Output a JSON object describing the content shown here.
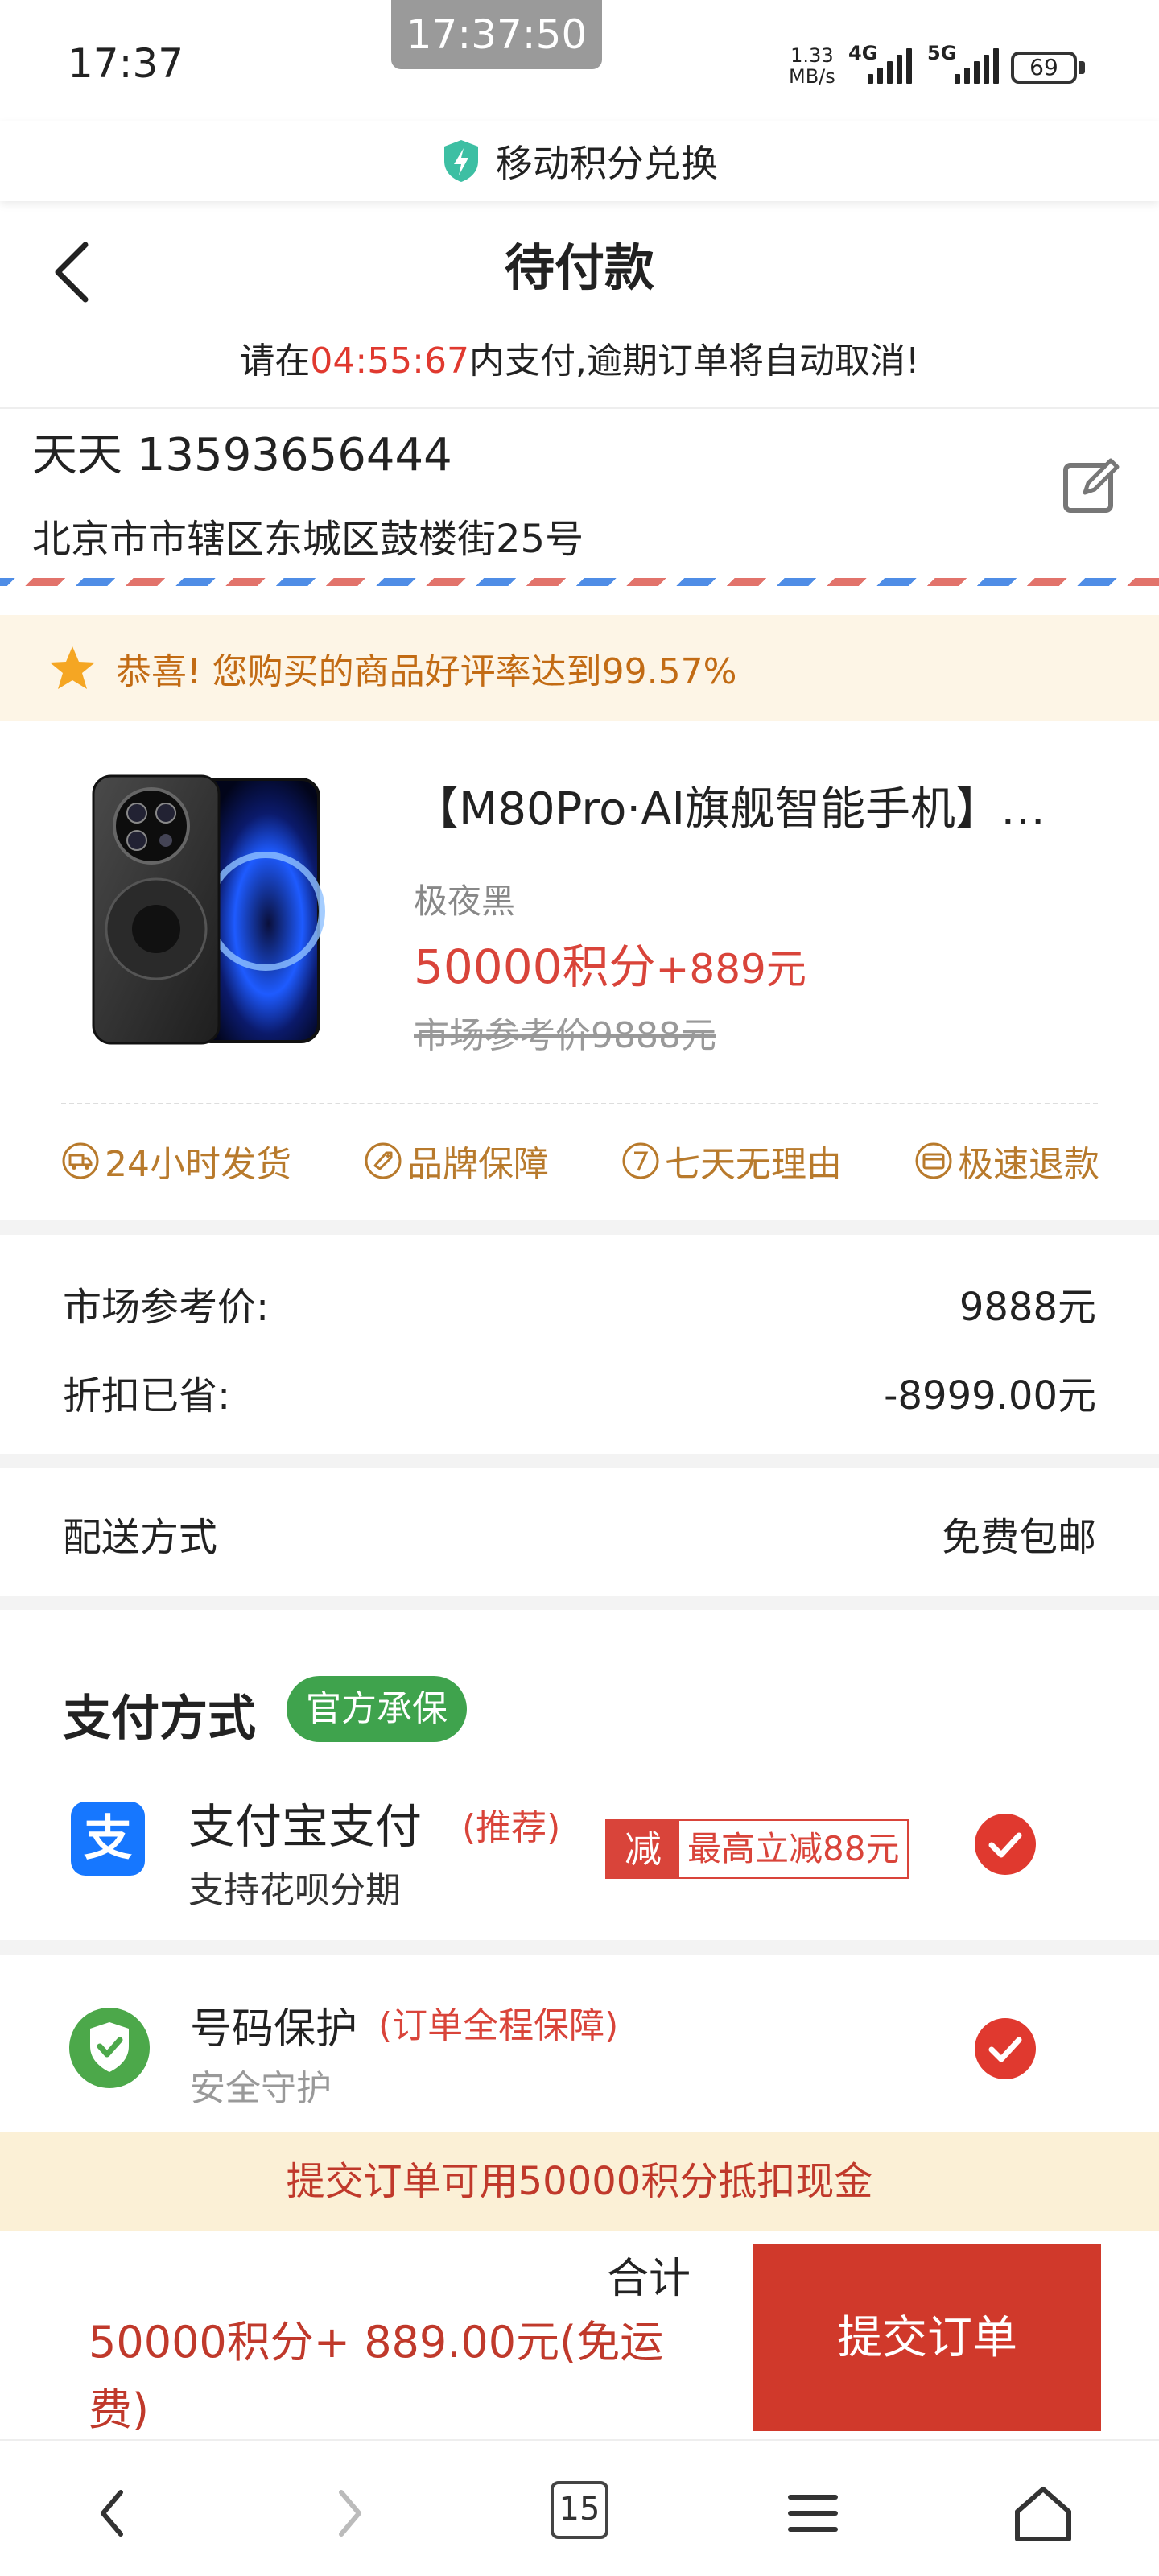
{
  "status_bar": {
    "time": "17:37",
    "overlay_time": "17:37:50",
    "net_speed_value": "1.33",
    "net_speed_unit": "MB/s",
    "signal1": "4G",
    "signal2": "5G",
    "battery": "69"
  },
  "site": {
    "name": "移动积分兑换"
  },
  "header": {
    "title": "待付款"
  },
  "countdown": {
    "prefix": "请在",
    "time": "04:55:67",
    "suffix": "内支付,逾期订单将自动取消!"
  },
  "address": {
    "name_phone": "天天 13593656444",
    "line": "北京市市辖区东城区鼓楼街25号"
  },
  "notice": {
    "text": "恭喜! 您购买的商品好评率达到99.57%"
  },
  "product": {
    "title": "【M80Pro·AI旗舰智能手机】…",
    "variant": "极夜黑",
    "price_points": "50000积分",
    "price_cash": "+889元",
    "original_price": "市场参考价9888元"
  },
  "features": [
    {
      "label": "24小时发货",
      "icon": "truck-icon"
    },
    {
      "label": "品牌保障",
      "icon": "tag-icon"
    },
    {
      "label": "七天无理由",
      "icon": "seven-icon"
    },
    {
      "label": "极速退款",
      "icon": "card-icon"
    }
  ],
  "price_rows": [
    {
      "label": "市场参考价:",
      "value": "9888元"
    },
    {
      "label": "折扣已省:",
      "value": "-8999.00元"
    }
  ],
  "shipping": {
    "label": "配送方式",
    "value": "免费包邮"
  },
  "payment": {
    "title": "支付方式",
    "badge": "官方承保",
    "alipay_glyph": "支",
    "alipay_name": "支付宝支付",
    "alipay_recommend": "(推荐)",
    "alipay_sub": "支持花呗分期",
    "promo_tag": "减",
    "promo_text": "最高立减88元"
  },
  "protection": {
    "name": "号码保护",
    "note": "(订单全程保障)",
    "sub": "安全守护"
  },
  "banner": {
    "text": "提交订单可用50000积分抵扣现金"
  },
  "footer": {
    "total_label": "合计",
    "total_amount": "50000积分+ 889.00元(免运费)",
    "submit": "提交订单"
  },
  "navbar": {
    "tabs_count": "15"
  },
  "colors": {
    "accent_red": "#d9443a",
    "gold": "#b87a2c",
    "green_badge": "#3fa34d",
    "alipay_blue": "#1677ff"
  }
}
